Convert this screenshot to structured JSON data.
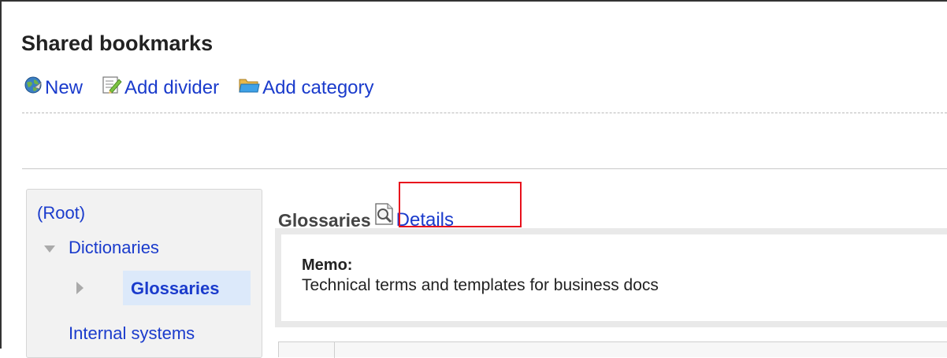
{
  "page": {
    "title": "Shared bookmarks"
  },
  "toolbar": {
    "new_label": "New",
    "add_divider_label": "Add divider",
    "add_category_label": "Add category"
  },
  "tree": {
    "root": "(Root)",
    "dictionaries": "Dictionaries",
    "glossaries": "Glossaries",
    "internal_systems": "Internal systems"
  },
  "category": {
    "title": "Glossaries",
    "details_label": "Details",
    "memo_label": "Memo:",
    "memo_text": "Technical terms and templates for business docs"
  },
  "colors": {
    "link": "#1a3bcc",
    "highlight": "#e8101c",
    "selected_bg": "#dce9fa"
  },
  "icons": [
    "globe-icon",
    "edit-divider-icon",
    "folder-icon",
    "details-magnifier-icon"
  ]
}
